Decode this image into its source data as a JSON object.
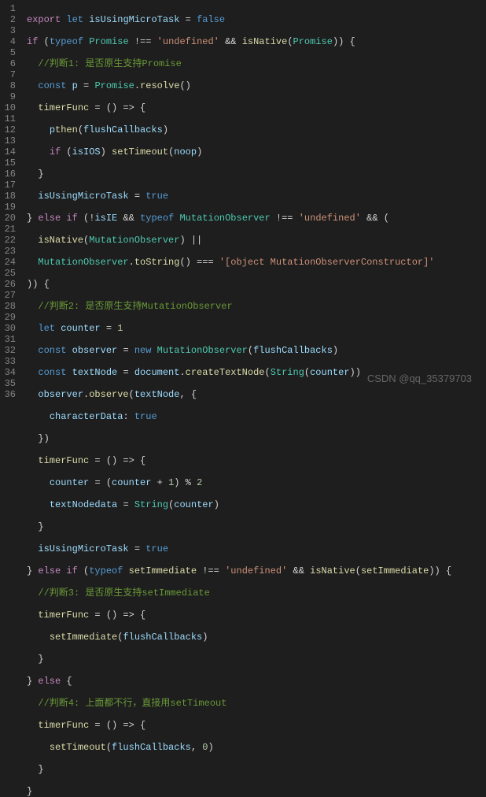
{
  "line_count": 36,
  "watermark": "CSDN @qq_35379703",
  "lines": {
    "l1": {
      "a": "export",
      "b": "let",
      "c": "isUsingMicroTask",
      "d": "=",
      "e": "false"
    },
    "l2": {
      "a": "if",
      "b": "(",
      "c": "typeof",
      "d": "Promise",
      "e": "!==",
      "f": "'undefined'",
      "g": "&&",
      "h": "isNative",
      "i": "(",
      "j": "Promise",
      "k": ")) {"
    },
    "l3": {
      "a": "//判断1: 是否原生支持",
      "b": "Promise"
    },
    "l4": {
      "a": "const",
      "b": "p",
      "c": "=",
      "d": "Promise",
      "e": ".",
      "f": "resolve",
      "g": "()"
    },
    "l5": {
      "a": "timerFunc",
      "b": "= () => {"
    },
    "l6": {
      "a": "p",
      ".": ".",
      "b": "then",
      "c": "(",
      "d": "flushCallbacks",
      "e": ")"
    },
    "l7": {
      "a": "if",
      "b": "(",
      "c": "isIOS",
      "d": ")",
      "e": "setTimeout",
      "f": "(",
      "g": "noop",
      "h": ")"
    },
    "l8": {
      "a": "}"
    },
    "l9": {
      "a": "isUsingMicroTask",
      "b": "=",
      "c": "true"
    },
    "l10": {
      "a": "}",
      "b": "else if",
      "c": "(!",
      "d": "isIE",
      "e": "&&",
      "f": "typeof",
      "g": "MutationObserver",
      "h": "!==",
      "i": "'undefined'",
      "j": "&& ("
    },
    "l11": {
      "a": "isNative",
      "b": "(",
      "c": "MutationObserver",
      "d": ") ||"
    },
    "l12": {
      "a": "MutationObserver",
      "b": ".",
      "c": "toString",
      "d": "() ===",
      "e": "'[object MutationObserverConstructor]'"
    },
    "l13": {
      "a": ")) {"
    },
    "l14": {
      "a": "//判断2: 是否原生支持",
      "b": "MutationObserver"
    },
    "l15": {
      "a": "let",
      "b": "counter",
      "c": "=",
      "d": "1"
    },
    "l16": {
      "a": "const",
      "b": "observer",
      "c": "=",
      "d": "new",
      "e": "MutationObserver",
      "f": "(",
      "g": "flushCallbacks",
      "h": ")"
    },
    "l17": {
      "a": "const",
      "b": "textNode",
      "c": "=",
      "d": "document",
      "e": ".",
      "f": "createTextNode",
      "g": "(",
      "h": "String",
      "i": "(",
      "j": "counter",
      "k": "))"
    },
    "l18": {
      "a": "observer",
      "b": ".",
      "c": "observe",
      "d": "(",
      "e": "textNode",
      "f": ", {"
    },
    "l19": {
      "a": "characterData",
      ":": ":",
      "b": "true"
    },
    "l20": {
      "a": "})"
    },
    "l21": {
      "a": "timerFunc",
      "b": "= () => {"
    },
    "l22": {
      "a": "counter",
      "b": "= (",
      "c": "counter",
      "d": "+",
      "e": "1",
      "f": ") %",
      "g": "2"
    },
    "l23": {
      "a": "textNode",
      ".": ".",
      "b": "data",
      "c": "=",
      "d": "String",
      "e": "(",
      "f": "counter",
      "g": ")"
    },
    "l24": {
      "a": "}"
    },
    "l25": {
      "a": "isUsingMicroTask",
      "b": "=",
      "c": "true"
    },
    "l26": {
      "a": "}",
      "b": "else if",
      "c": "(",
      "d": "typeof",
      "e": "setImmediate",
      "f": "!==",
      "g": "'undefined'",
      "h": "&&",
      "i": "isNative",
      "j": "(",
      "k": "setImmediate",
      "l": ")) {"
    },
    "l27": {
      "a": "//判断3: 是否原生支持",
      "b": "setImmediate"
    },
    "l28": {
      "a": "timerFunc",
      "b": "= () => {"
    },
    "l29": {
      "a": "setImmediate",
      "b": "(",
      "c": "flushCallbacks",
      "d": ")"
    },
    "l30": {
      "a": "}"
    },
    "l31": {
      "a": "}",
      "b": "else",
      "c": "{"
    },
    "l32": {
      "a": "//判断4: 上面都不行，直接用",
      "b": "setTimeout"
    },
    "l33": {
      "a": "timerFunc",
      "b": "= () => {"
    },
    "l34": {
      "a": "setTimeout",
      "b": "(",
      "c": "flushCallbacks",
      "d": ",",
      "e": "0",
      "f": ")"
    },
    "l35": {
      "a": "}"
    },
    "l36": {
      "a": "}"
    }
  }
}
